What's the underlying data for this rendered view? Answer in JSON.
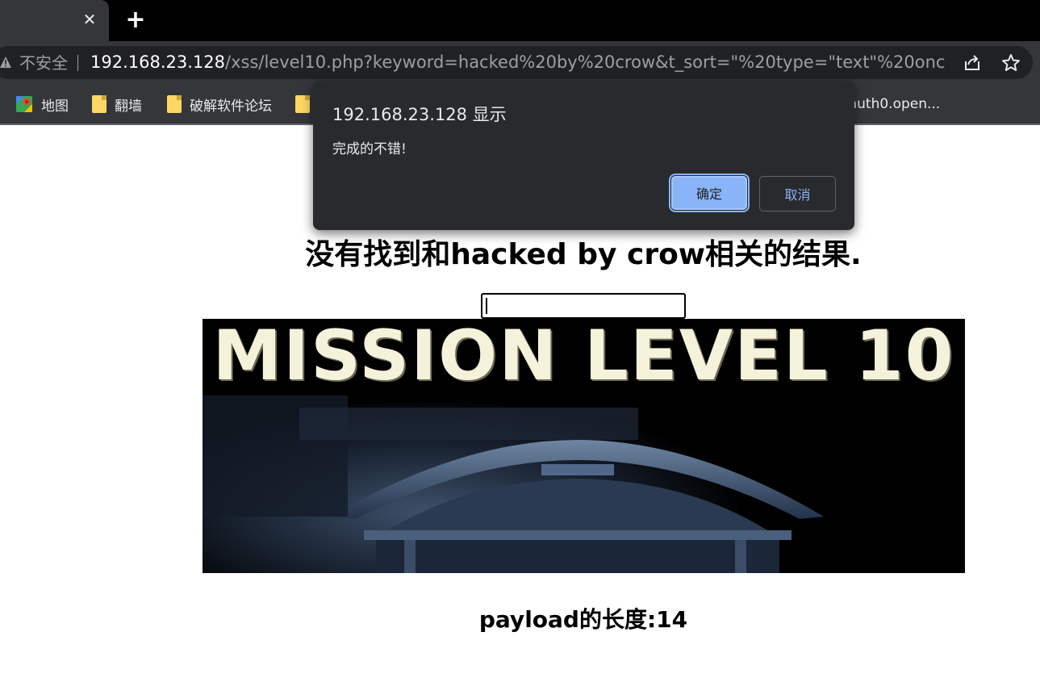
{
  "tab": {
    "close_glyph": "✕",
    "new_tab_glyph": "+"
  },
  "address_bar": {
    "security_label": "不安全",
    "url_host": "192.168.23.128",
    "url_path": "/xss/level10.php?keyword=hacked%20by%20crow&t_sort=\"%20type=\"text\"%20onclick=..."
  },
  "bookmarks": {
    "items": [
      {
        "label": "地图",
        "icon": "google-maps-icon"
      },
      {
        "label": "翻墙",
        "icon": "folder-icon"
      },
      {
        "label": "破解软件论坛",
        "icon": "folder-icon"
      },
      {
        "label": "",
        "icon": "folder-icon"
      }
    ],
    "overflow_label": "/auth0.open..."
  },
  "dialog": {
    "title": "192.168.23.128 显示",
    "message": "完成的不错!",
    "ok_label": "确定",
    "cancel_label": "取消"
  },
  "page": {
    "result_heading": "没有找到和hacked by crow相关的结果.",
    "keyword_input_value": "",
    "banner_title": "MISSION LEVEL 10",
    "payload_length": "payload的长度:14"
  },
  "colors": {
    "tabstrip_bg": "#000000",
    "toolbar_bg": "#35363a",
    "omnibox_bg": "#202124",
    "dialog_bg": "#292a2d",
    "accent": "#8ab4f8"
  }
}
